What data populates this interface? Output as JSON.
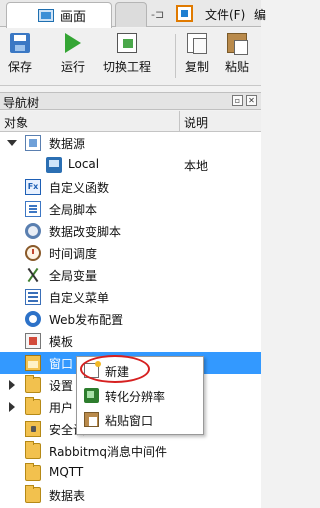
{
  "tabs": [
    {
      "label": "画面",
      "active": true
    },
    {
      "label": "",
      "active": false
    }
  ],
  "menu": {
    "file": "文件(F)",
    "edit": "编"
  },
  "pin_glyph": "-⊐",
  "toolbar": {
    "save": "保存",
    "run": "运行",
    "switch": "切换工程",
    "copy": "复制",
    "paste": "粘贴"
  },
  "panel": {
    "title": "导航树",
    "restore_glyph": "▫",
    "close_glyph": "✕",
    "col_object": "对象",
    "col_desc": "说明"
  },
  "tree": {
    "items": [
      {
        "label": "数据源",
        "icon": "datasource-icon",
        "expanded": true
      },
      {
        "label": "Local",
        "desc": "本地",
        "icon": "local-icon"
      },
      {
        "label": "自定义函数",
        "icon": "fx-icon"
      },
      {
        "label": "全局脚本",
        "icon": "script-icon"
      },
      {
        "label": "数据改变脚本",
        "icon": "gear-icon"
      },
      {
        "label": "时间调度",
        "icon": "clock-icon"
      },
      {
        "label": "全局变量",
        "icon": "variable-icon"
      },
      {
        "label": "自定义菜单",
        "icon": "menu-icon"
      },
      {
        "label": "Web发布配置",
        "icon": "web-icon"
      },
      {
        "label": "模板",
        "icon": "template-icon"
      },
      {
        "label": "窗口",
        "icon": "window-icon",
        "selected": true
      },
      {
        "label": "设置",
        "icon": "folder-icon",
        "collapsed": true
      },
      {
        "label": "用户",
        "icon": "folder-icon",
        "collapsed": true
      },
      {
        "label": "安全设置",
        "icon": "lock-icon"
      },
      {
        "label": "Rabbitmq消息中间件",
        "icon": "folder-icon"
      },
      {
        "label": "MQTT",
        "icon": "folder-icon"
      },
      {
        "label": "数据表",
        "icon": "folder-icon"
      }
    ]
  },
  "context_menu": {
    "items": [
      {
        "label": "新建",
        "icon": "new-icon"
      },
      {
        "label": "转化分辨率",
        "icon": "convert-icon"
      },
      {
        "label": "粘贴窗口",
        "icon": "paste-window-icon"
      }
    ]
  },
  "colors": {
    "selection": "#3399ff",
    "highlight_circle": "#d62020"
  }
}
